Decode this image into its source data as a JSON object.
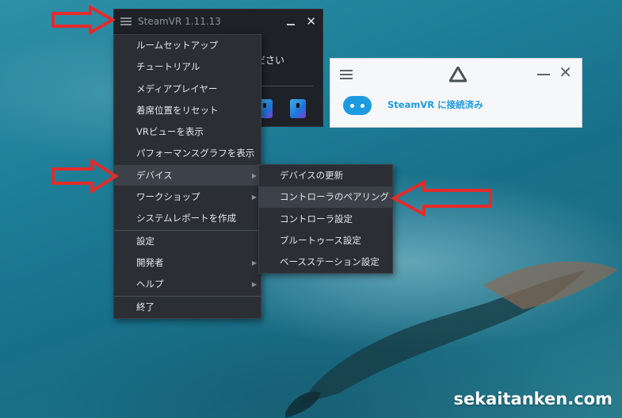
{
  "window": {
    "title": "SteamVR 1.11.13",
    "message_partial": "ださい"
  },
  "main_menu": {
    "items": [
      {
        "label": "ルームセットアップ",
        "has_sub": false
      },
      {
        "label": "チュートリアル",
        "has_sub": false
      },
      {
        "label": "メディアプレイヤー",
        "has_sub": false
      },
      {
        "label": "着席位置をリセット",
        "has_sub": false
      },
      {
        "label": "VRビューを表示",
        "has_sub": false
      },
      {
        "label": "パフォーマンスグラフを表示",
        "has_sub": false
      },
      {
        "label": "デバイス",
        "has_sub": true,
        "highlighted": true
      },
      {
        "label": "ワークショップ",
        "has_sub": true
      },
      {
        "label": "システムレポートを作成",
        "has_sub": false
      },
      {
        "label": "設定",
        "has_sub": false
      },
      {
        "label": "開発者",
        "has_sub": true
      },
      {
        "label": "ヘルプ",
        "has_sub": true
      },
      {
        "label": "終了",
        "has_sub": false
      }
    ]
  },
  "sub_menu": {
    "items": [
      {
        "label": "デバイスの更新"
      },
      {
        "label": "コントローラのペアリング",
        "highlighted": true
      },
      {
        "label": "コントローラ設定"
      },
      {
        "label": "ブルートゥース設定"
      },
      {
        "label": "ベースステーション設定"
      }
    ]
  },
  "status_panel": {
    "status": "SteamVR に接続済み"
  },
  "watermark": "sekaitanken.com",
  "colors": {
    "annotation_arrow": "#e32b2b",
    "accent": "#1d9be0",
    "menu_bg": "#2b2f35"
  }
}
